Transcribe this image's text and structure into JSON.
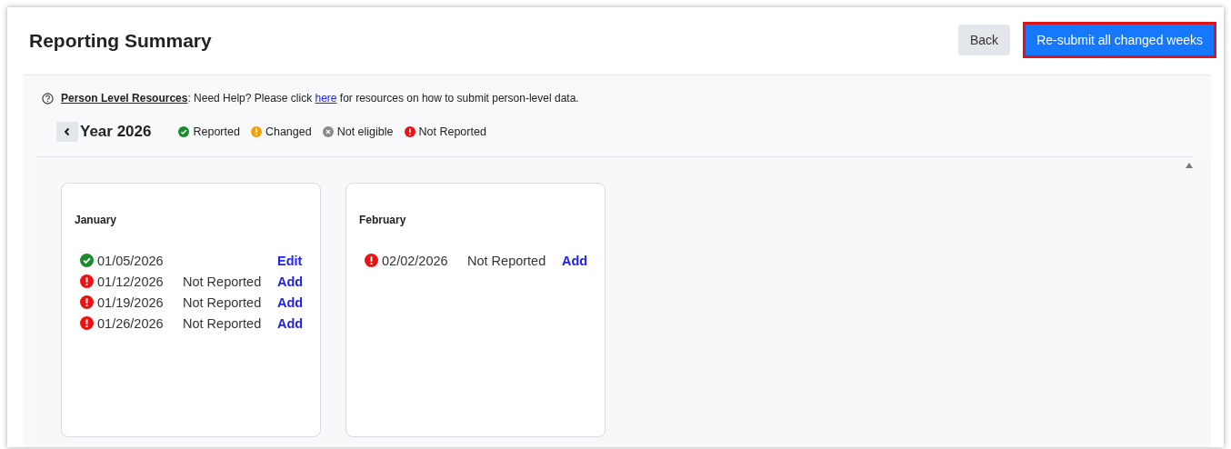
{
  "title": "Reporting Summary",
  "buttons": [
    {
      "label": "Back",
      "kind": "secondary"
    },
    {
      "label": "Re-submit all changed weeks",
      "kind": "primary"
    }
  ],
  "help": {
    "heading": "Person Level Resources",
    "before": ": Need Help? Please click ",
    "link": "here",
    "after": " for resources on how to submit person-level data."
  },
  "year": "Year 2026",
  "legend": [
    {
      "kind": "reported",
      "label": "Reported"
    },
    {
      "kind": "changed",
      "label": "Changed"
    },
    {
      "kind": "not_eligible",
      "label": "Not eligible"
    },
    {
      "kind": "not_reported",
      "label": "Not Reported"
    }
  ],
  "months": [
    {
      "name": "January",
      "weeks": [
        {
          "kind": "reported",
          "date": "01/05/2026",
          "action": "Edit"
        },
        {
          "kind": "not_reported",
          "date": "01/12/2026",
          "status_text": "Not Reported",
          "action": "Add"
        },
        {
          "kind": "not_reported",
          "date": "01/19/2026",
          "status_text": "Not Reported",
          "action": "Add"
        },
        {
          "kind": "not_reported",
          "date": "01/26/2026",
          "status_text": "Not Reported",
          "action": "Add"
        }
      ]
    },
    {
      "name": "February",
      "weeks": [
        {
          "kind": "not_reported",
          "date": "02/02/2026",
          "status_text": "Not Reported",
          "action": "Add"
        }
      ]
    }
  ]
}
